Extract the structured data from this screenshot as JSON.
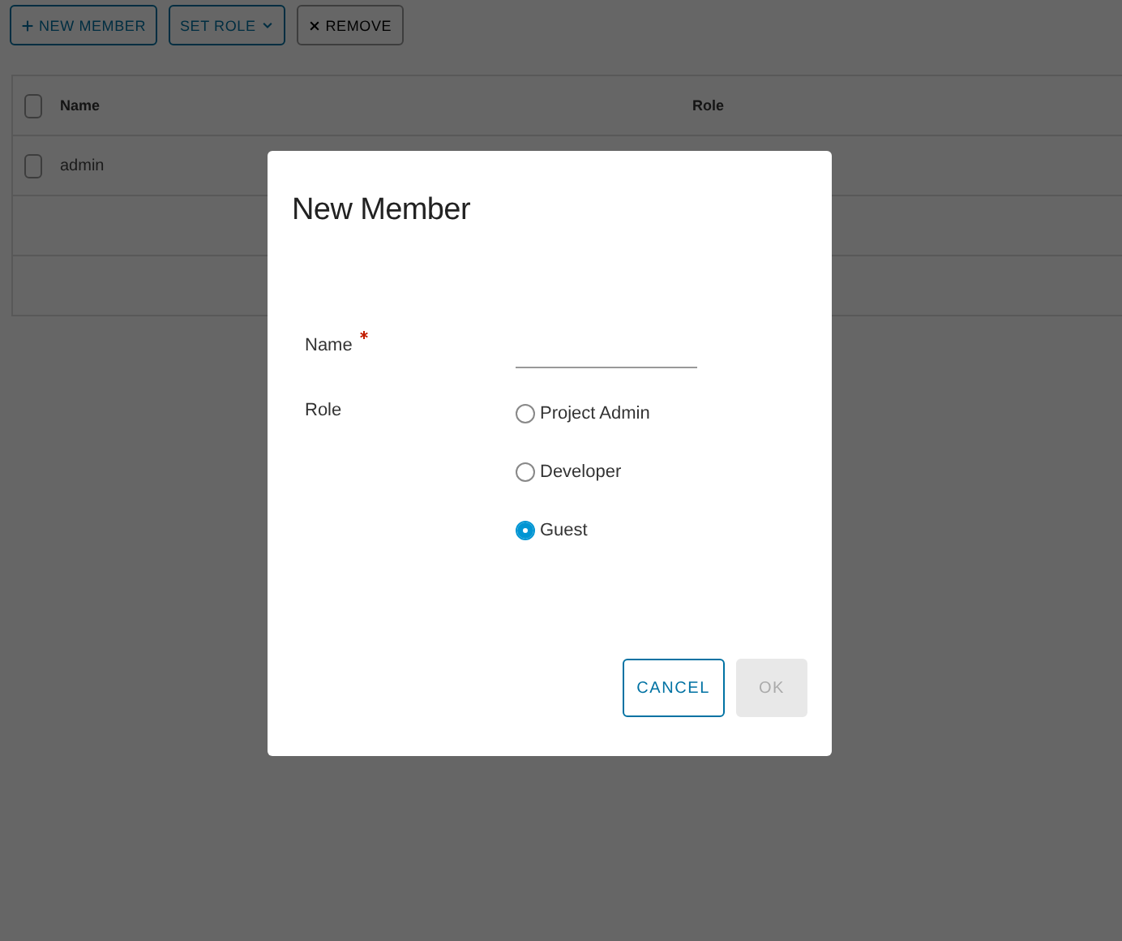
{
  "toolbar": [
    {
      "label": "NEW MEMBER",
      "kind": "add",
      "disabled": false
    },
    {
      "label": "SET ROLE",
      "kind": "dropdown",
      "disabled": false
    },
    {
      "label": "REMOVE",
      "kind": "remove",
      "disabled": true
    }
  ],
  "table": {
    "all_checked": false,
    "columns": [
      "Name",
      "Role"
    ],
    "rows": [
      {
        "name": "admin",
        "checked": false
      }
    ]
  },
  "dialog": {
    "title": "New Member",
    "name_field": {
      "label": "Name",
      "required": true
    },
    "role": {
      "label": "Role",
      "options": [
        {
          "label": "Project Admin",
          "selected": false
        },
        {
          "label": "Developer",
          "selected": false
        },
        {
          "label": "Guest",
          "selected": true
        }
      ]
    },
    "buttons": [
      {
        "label": "CANCEL",
        "kind": "outline",
        "disabled": false
      },
      {
        "label": "OK",
        "kind": "primary",
        "disabled": true
      }
    ]
  }
}
